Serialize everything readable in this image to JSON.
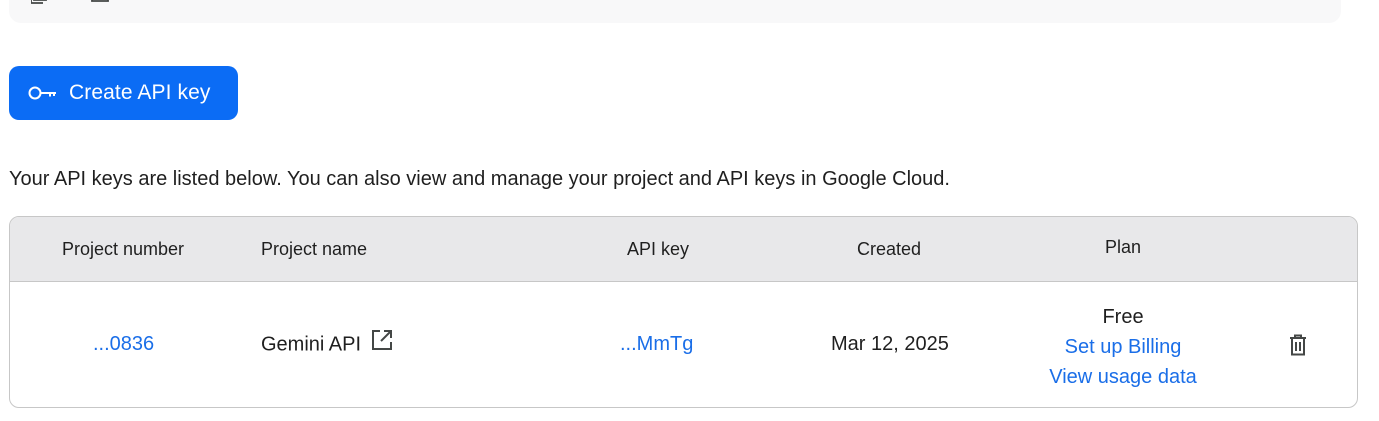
{
  "top_panel": {
    "icons": [
      "copy-icon",
      "document-icon"
    ]
  },
  "create_button": {
    "icon": "key-icon",
    "label": "Create API key"
  },
  "intro_text": "Your API keys are listed below. You can also view and manage your project and API keys in Google Cloud.",
  "table": {
    "columns": {
      "project_number": "Project number",
      "project_name": "Project name",
      "api_key": "API key",
      "created": "Created",
      "plan": "Plan"
    },
    "rows": [
      {
        "project_number": "...0836",
        "project_name": "Gemini API",
        "project_name_icon": "open-in-new-icon",
        "api_key": "...MmTg",
        "created": "Mar 12, 2025",
        "plan": "Free",
        "setup_billing": "Set up Billing",
        "view_usage": "View usage data",
        "action_icon": "trash-icon"
      }
    ]
  },
  "colors": {
    "accent": "#0b6cf5",
    "link": "#1a6ee8",
    "header_bg": "#e8e8ea",
    "border": "#c7c7c7"
  }
}
